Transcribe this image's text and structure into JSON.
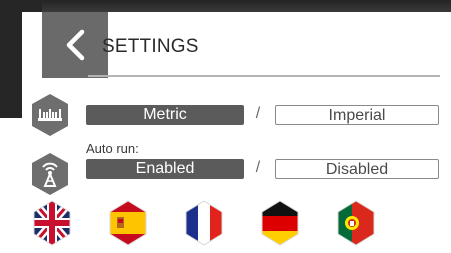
{
  "header": {
    "title": "SETTINGS",
    "back_icon": "chevron-left-icon"
  },
  "units": {
    "icon": "ruler-icon",
    "option_a": "Metric",
    "separator": "/",
    "option_b": "Imperial",
    "selected": "Metric"
  },
  "autorun": {
    "icon": "antenna-icon",
    "label": "Auto run:",
    "option_a": "Enabled",
    "separator": "/",
    "option_b": "Disabled",
    "selected": "Enabled"
  },
  "languages": [
    {
      "name": "uk-flag-icon"
    },
    {
      "name": "spain-flag-icon"
    },
    {
      "name": "france-flag-icon"
    },
    {
      "name": "germany-flag-icon"
    },
    {
      "name": "portugal-flag-icon"
    }
  ],
  "colors": {
    "panel_bg": "#ffffff",
    "active_segment": "#5b5b5b",
    "back_button": "#6a6a6a",
    "icon_hex": "#6e6e6e"
  }
}
